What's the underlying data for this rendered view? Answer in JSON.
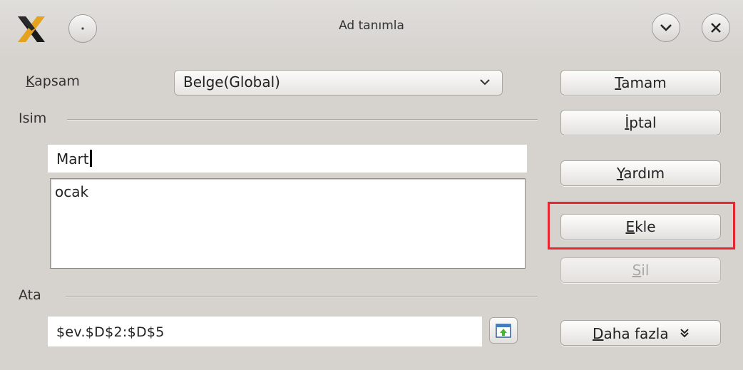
{
  "window": {
    "title": "Ad tanımla",
    "logo_icon": "x-app-logo",
    "menu_icon": "window-menu-icon",
    "minimize_icon": "chevron-down-icon",
    "close_icon": "close-icon"
  },
  "scope": {
    "label_ul": "K",
    "label_rest": "apsam",
    "value": "Belge(Global)",
    "dropdown_icon": "chevron-down-icon"
  },
  "name_section": {
    "label": "Isim",
    "input_value": "Mart",
    "list_items": [
      "ocak"
    ]
  },
  "assign_section": {
    "label": "Ata",
    "reference": "$ev.$D$2:$D$5",
    "shrink_icon": "shrink-dialog-icon"
  },
  "buttons": {
    "ok": {
      "ul": "T",
      "rest": "amam"
    },
    "cancel": {
      "ul": "İ",
      "rest": "ptal"
    },
    "help": {
      "ul": "Y",
      "rest": "ardım"
    },
    "add": {
      "ul": "E",
      "rest": "kle"
    },
    "delete": {
      "ul": "S",
      "rest": "il"
    },
    "more": {
      "ul": "D",
      "rest": "aha fazla",
      "icon": "double-chevron-down-icon"
    }
  },
  "colors": {
    "highlight": "#e8262f",
    "background": "#d6d3cf"
  }
}
